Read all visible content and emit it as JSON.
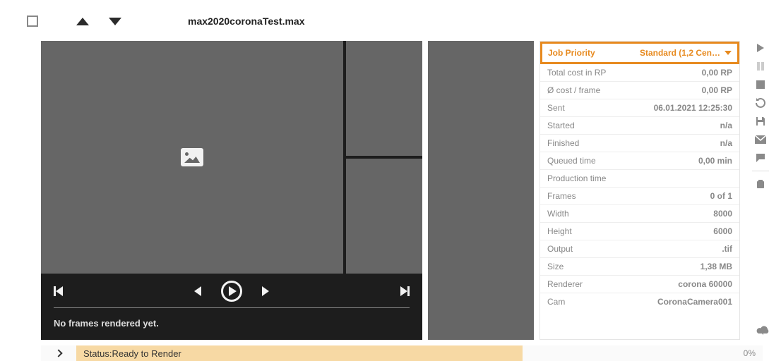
{
  "header": {
    "filename": "max2020coronaTest.max"
  },
  "player": {
    "message": "No frames rendered yet."
  },
  "job": {
    "priority_label": "Job Priority",
    "priority_value": "Standard (1,2 Cen…"
  },
  "info": [
    {
      "label": "Total cost in RP",
      "value": "0,00 RP"
    },
    {
      "label": "Ø cost / frame",
      "value": "0,00 RP"
    },
    {
      "label": "Sent",
      "value": "06.01.2021 12:25:30"
    },
    {
      "label": "Started",
      "value": "n/a"
    },
    {
      "label": "Finished",
      "value": "n/a"
    },
    {
      "label": "Queued time",
      "value": "0,00 min"
    },
    {
      "label": "Production time",
      "value": ""
    },
    {
      "label": "Frames",
      "value": "0 of 1"
    },
    {
      "label": "Width",
      "value": "8000"
    },
    {
      "label": "Height",
      "value": "6000"
    },
    {
      "label": "Output",
      "value": ".tif"
    },
    {
      "label": "Size",
      "value": "1,38 MB"
    },
    {
      "label": "Renderer",
      "value": "corona 60000"
    },
    {
      "label": "Cam",
      "value": "CoronaCamera001"
    }
  ],
  "status": {
    "label_prefix": "Status: ",
    "text": "Ready to Render",
    "progress": "0%"
  }
}
